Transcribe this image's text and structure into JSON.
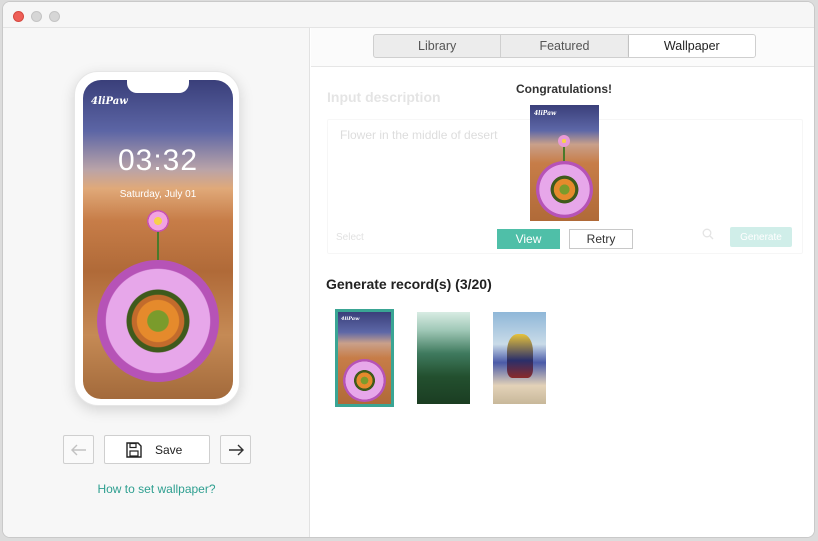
{
  "window": {
    "controls": [
      "close",
      "minimize",
      "zoom"
    ]
  },
  "left_panel": {
    "phone": {
      "brand": "4liPaw",
      "time": "03:32",
      "date": "Saturday, July 01"
    },
    "controls": {
      "prev_icon": "arrow-left-icon",
      "save_label": "Save",
      "save_icon": "floppy-disk-icon",
      "next_icon": "arrow-right-icon"
    },
    "help_link": "How to set wallpaper?"
  },
  "tabs": [
    {
      "label": "Library",
      "active": false
    },
    {
      "label": "Featured",
      "active": false
    },
    {
      "label": "Wallpaper",
      "active": true
    }
  ],
  "form": {
    "input_label": "Input description",
    "description_value": "Flower in the middle of desert",
    "option_label": "Select",
    "generate_label": "Generate"
  },
  "popup": {
    "title": "Congratulations!",
    "preview_brand": "4liPaw",
    "view_label": "View",
    "retry_label": "Retry"
  },
  "records": {
    "title": "Generate record(s) (3/20)",
    "items": [
      {
        "name": "desert-flower",
        "selected": true,
        "brand": "4liPaw"
      },
      {
        "name": "green-mountains",
        "selected": false
      },
      {
        "name": "motorcycle-rider",
        "selected": false
      }
    ]
  },
  "colors": {
    "accent": "#2e9f90",
    "button_green": "#4fbfa8",
    "close_red": "#ee5f57"
  }
}
